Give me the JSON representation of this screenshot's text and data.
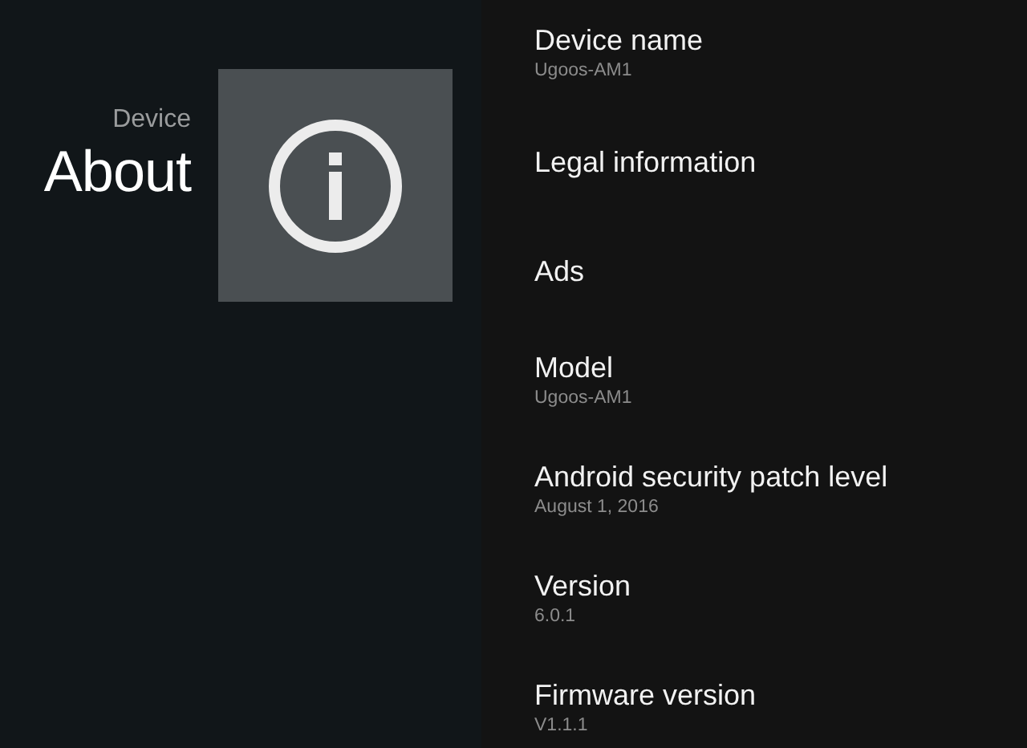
{
  "header": {
    "category": "Device",
    "title": "About"
  },
  "items": [
    {
      "title": "Device name",
      "summary": "Ugoos-AM1"
    },
    {
      "title": "Legal information"
    },
    {
      "title": "Ads"
    },
    {
      "title": "Model",
      "summary": "Ugoos-AM1"
    },
    {
      "title": "Android security patch level",
      "summary": "August 1, 2016"
    },
    {
      "title": "Version",
      "summary": "6.0.1"
    },
    {
      "title": "Firmware version",
      "summary": "V1.1.1"
    }
  ]
}
